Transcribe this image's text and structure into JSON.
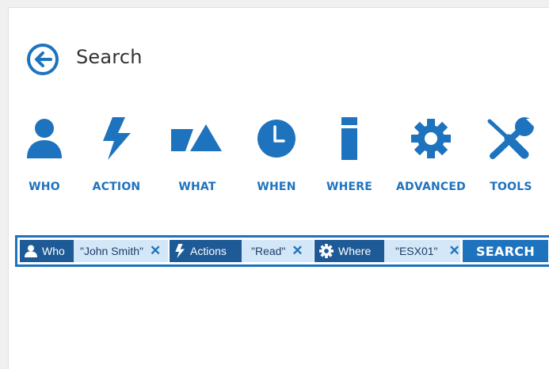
{
  "header": {
    "title": "Search"
  },
  "categories": [
    {
      "label": "WHO",
      "icon": "person-icon"
    },
    {
      "label": "ACTION",
      "icon": "lightning-icon"
    },
    {
      "label": "WHAT",
      "icon": "shapes-icon"
    },
    {
      "label": "WHEN",
      "icon": "clock-icon"
    },
    {
      "label": "WHERE",
      "icon": "server-icon"
    },
    {
      "label": "ADVANCED",
      "icon": "gear-icon"
    },
    {
      "label": "TOOLS",
      "icon": "tools-icon"
    }
  ],
  "filters": [
    {
      "key": "Who",
      "value": "\"John Smith\"",
      "icon": "person-icon"
    },
    {
      "key": "Actions",
      "value": "\"Read\"",
      "icon": "lightning-icon"
    },
    {
      "key": "Where",
      "value": "\"ESX01\"",
      "icon": "gear-icon"
    }
  ],
  "remove_glyph": "✕",
  "search_button": "SEARCH",
  "colors": {
    "accent": "#1e73be",
    "chip_dark": "#1e5a96",
    "chip_light": "#d3e7f8"
  }
}
